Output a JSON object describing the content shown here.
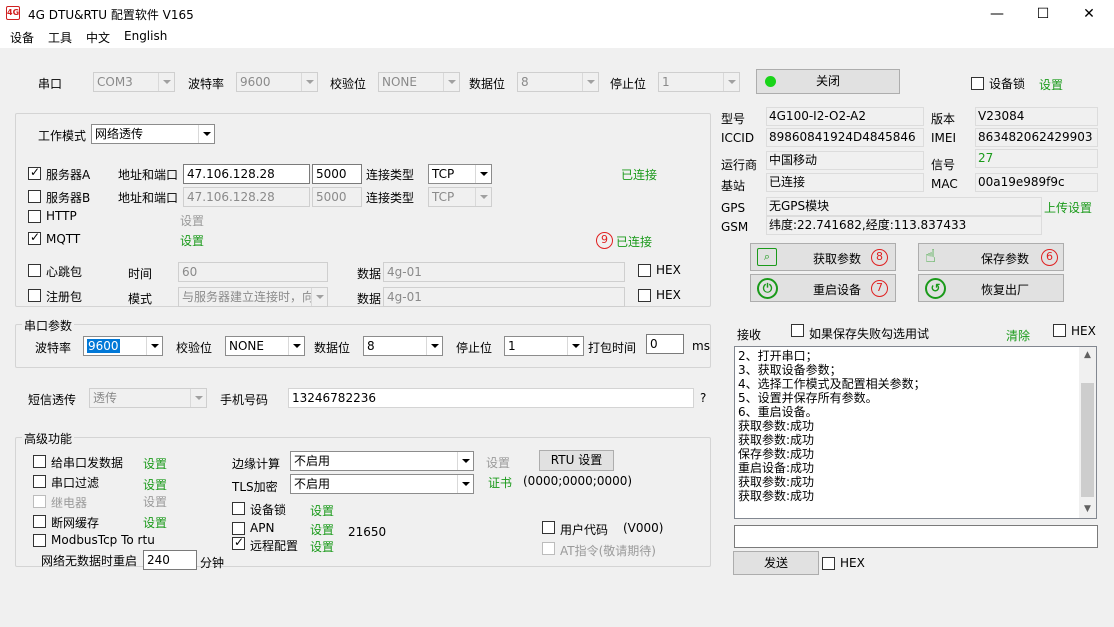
{
  "window": {
    "title": "4G DTU&RTU 配置软件  V165",
    "app_icon": "app-icon",
    "minimize": "—",
    "maximize": "☐",
    "close": "✕"
  },
  "menu": [
    "设备",
    "工具",
    "中文",
    "English"
  ],
  "serial": {
    "port_label": "串口",
    "port": "COM3",
    "baud_label": "波特率",
    "baud": "9600",
    "parity_label": "校验位",
    "parity": "NONE",
    "data_label": "数据位",
    "data": "8",
    "stop_label": "停止位",
    "stop": "1",
    "close_button": "关闭",
    "lock_label": "设备锁",
    "setting": "设置",
    "status_color": "#19d419"
  },
  "work": {
    "mode_label": "工作模式",
    "mode": "网络透传",
    "addr_label": "地址和端口",
    "type_label": "连接类型",
    "server_a": {
      "label": "服务器A",
      "host": "47.106.128.28",
      "port": "5000",
      "type": "TCP",
      "status": "已连接"
    },
    "server_b": {
      "label": "服务器B",
      "host": "47.106.128.28",
      "port": "5000",
      "type": "TCP"
    },
    "http": {
      "label": "HTTP",
      "setting": "设置"
    },
    "mqtt": {
      "label": "MQTT",
      "setting": "设置",
      "num": "9",
      "status": "已连接"
    },
    "heartbeat": {
      "label": "心跳包",
      "time_label": "时间",
      "time": "60",
      "data_label": "数据",
      "data": "4g-01",
      "hex": "HEX"
    },
    "register": {
      "label": "注册包",
      "mode_label": "模式",
      "mode": "与服务器建立连接时，向",
      "data_label": "数据",
      "data": "4g-01",
      "hex": "HEX"
    }
  },
  "info": {
    "model_label": "型号",
    "model": "4G100-I2-O2-A2",
    "version_label": "版本",
    "version": "V23084",
    "iccid_label": "ICCID",
    "iccid": "89860841924D4845846",
    "imei_label": "IMEI",
    "imei": "863482062429903",
    "operator_label": "运行商",
    "operator": "中国移动",
    "signal_label": "信号",
    "signal": "27",
    "station_label": "基站",
    "station": "已连接",
    "mac_label": "MAC",
    "mac": "00a19e989f9c",
    "gps_label": "GPS",
    "gps": "无GPS模块",
    "upload": "上传设置",
    "gsm_label": "GSM",
    "gsm": "纬度:22.741682,经度:113.837433"
  },
  "actions": {
    "get": {
      "label": "获取参数",
      "num": "8"
    },
    "save": {
      "label": "保存参数",
      "num": "6"
    },
    "restart": {
      "label": "重启设备",
      "num": "7"
    },
    "reset": {
      "label": "恢复出厂"
    }
  },
  "uart": {
    "title": "串口参数",
    "baud_label": "波特率",
    "baud": "9600",
    "parity_label": "校验位",
    "parity": "NONE",
    "data_label": "数据位",
    "data": "8",
    "stop_label": "停止位",
    "stop": "1",
    "pack_label": "打包时间",
    "pack": "0",
    "unit": "ms"
  },
  "sms": {
    "label": "短信透传",
    "mode": "透传",
    "phone_label": "手机号码",
    "phone": "13246782236",
    "help": "?"
  },
  "advanced": {
    "title": "高级功能",
    "uart_send": {
      "label": "给串口发数据",
      "setting": "设置"
    },
    "uart_filter": {
      "label": "串口过滤",
      "setting": "设置"
    },
    "relay": {
      "label": "继电器",
      "setting": "设置"
    },
    "offline_cache": {
      "label": "断网缓存",
      "setting": "设置"
    },
    "modbus": {
      "label": "ModbusTcp To rtu"
    },
    "nodata_label": "网络无数据时重启",
    "nodata": "240",
    "nodata_unit": "分钟",
    "edge_label": "边缘计算",
    "edge": "不启用",
    "edge_setting": "设置",
    "rtu_button": "RTU 设置",
    "tls_label": "TLS加密",
    "tls": "不启用",
    "cert": "证书",
    "cert_value": "(0000;0000;0000)",
    "lock": {
      "label": "设备锁",
      "setting": "设置"
    },
    "apn": {
      "label": "APN",
      "setting": "设置",
      "value": "21650"
    },
    "remote": {
      "label": "远程配置",
      "setting": "设置"
    },
    "user_code": {
      "label": "用户代码",
      "value": "(V000)"
    },
    "at_cmd": {
      "label": "AT指令(敬请期待)"
    }
  },
  "receive": {
    "label": "接收",
    "save_fail_label": "如果保存失败勾选用试",
    "clear": "清除",
    "hex": "HEX",
    "lines": [
      "2、打开串口；",
      "3、获取设备参数；",
      "4、选择工作模式及配置相关参数；",
      "5、设置并保存所有参数。",
      "6、重启设备。",
      "获取参数:成功",
      "获取参数:成功",
      "保存参数:成功",
      "重启设备:成功",
      "获取参数:成功",
      "获取参数:成功"
    ],
    "send_button": "发送",
    "send_hex": "HEX"
  }
}
